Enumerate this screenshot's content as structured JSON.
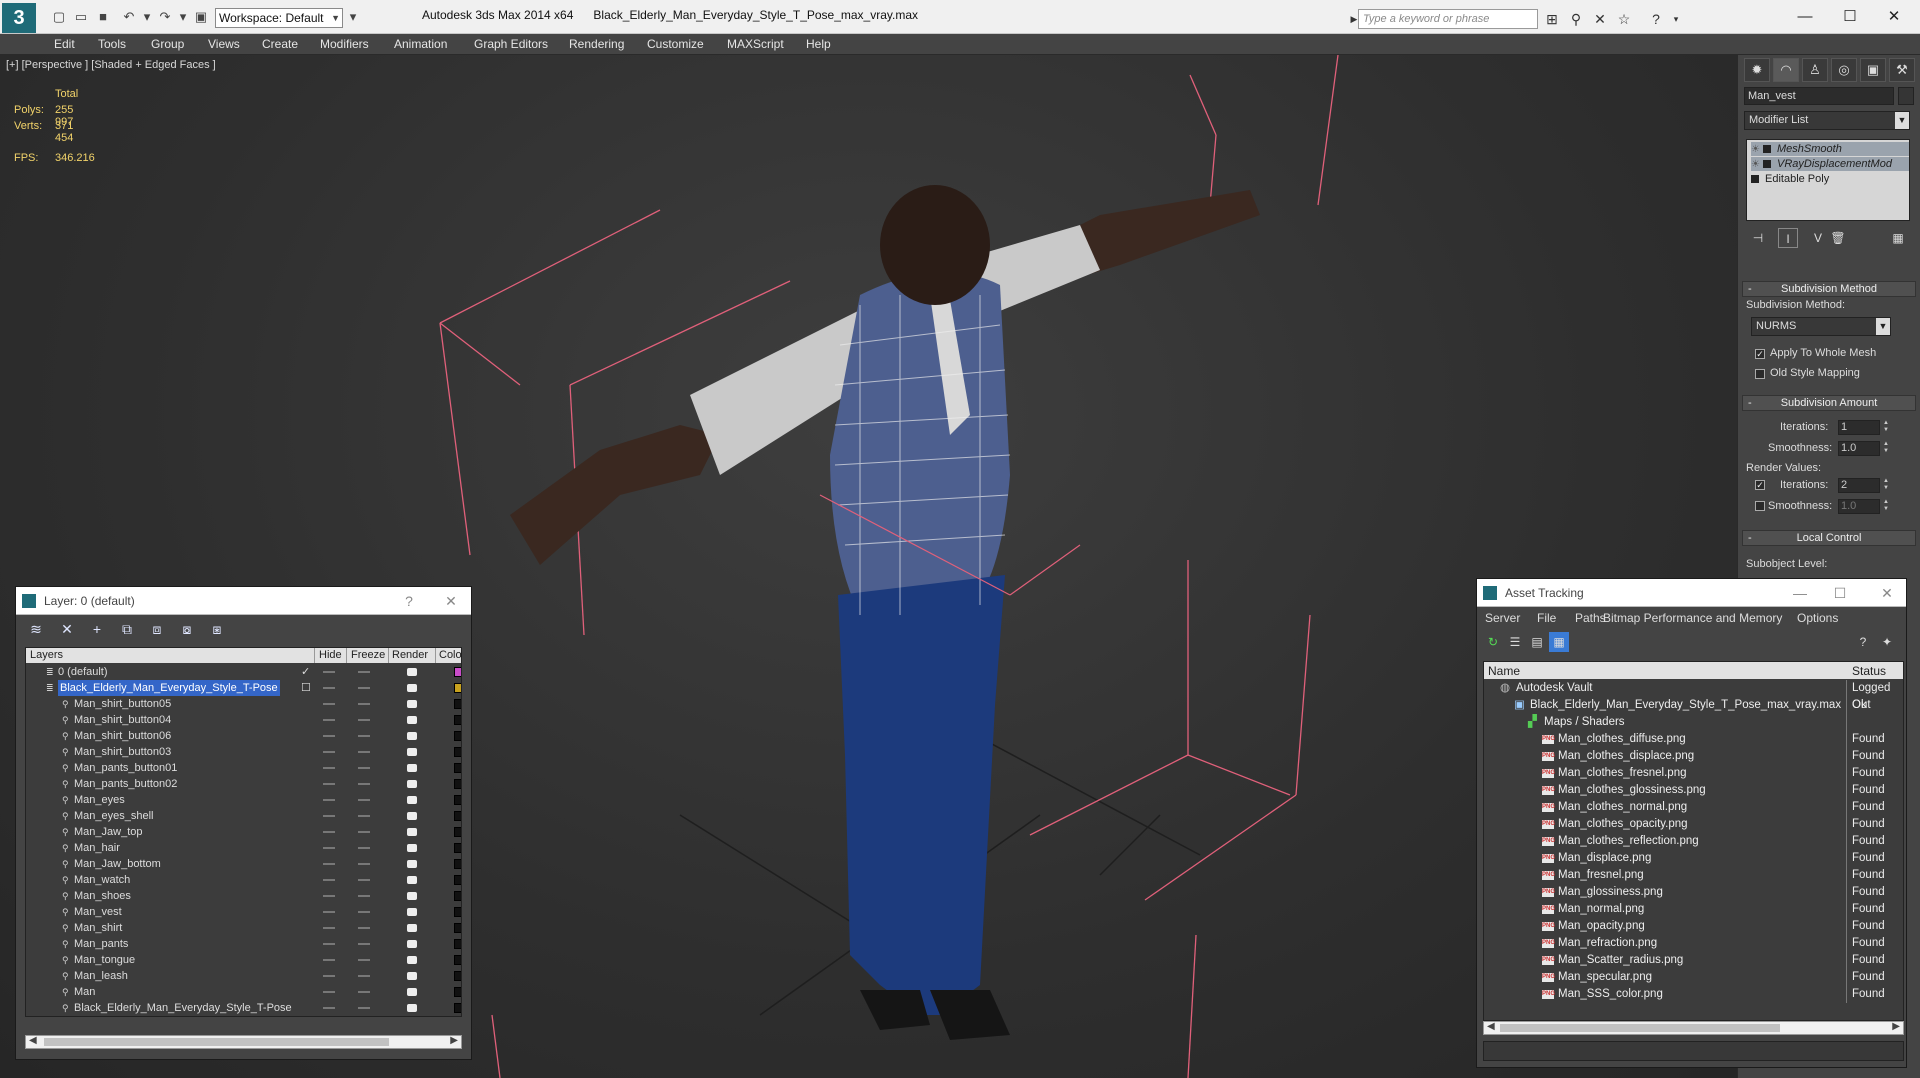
{
  "app": {
    "logo_text": "3",
    "workspace": "Workspace: Default",
    "title": "Autodesk 3ds Max  2014 x64",
    "file": "Black_Elderly_Man_Everyday_Style_T_Pose_max_vray.max",
    "search_placeholder": "Type a keyword or phrase"
  },
  "menu": [
    "Edit",
    "Tools",
    "Group",
    "Views",
    "Create",
    "Modifiers",
    "Animation",
    "Graph Editors",
    "Rendering",
    "Customize",
    "MAXScript",
    "Help"
  ],
  "viewport": {
    "label": "[+] [Perspective ] [Shaded + Edged Faces ]",
    "stats": {
      "total_label": "Total",
      "polys_label": "Polys:",
      "polys": "255 997",
      "verts_label": "Verts:",
      "verts": "371 454",
      "fps_label": "FPS:",
      "fps": "346.216"
    }
  },
  "command_panel": {
    "object_name": "Man_vest",
    "modifier_list": "Modifier List",
    "stack": [
      "MeshSmooth",
      "VRayDisplacementMod",
      "Editable Poly"
    ],
    "subdivision_method_title": "Subdivision Method",
    "subdivision_method_label": "Subdivision Method:",
    "subdivision_method_value": "NURMS",
    "apply_whole_mesh": "Apply To Whole Mesh",
    "old_style_mapping": "Old Style Mapping",
    "subdivision_amount_title": "Subdivision Amount",
    "iterations_label": "Iterations:",
    "iterations": "1",
    "smoothness_label": "Smoothness:",
    "smoothness": "1.0",
    "render_values_label": "Render Values:",
    "render_iterations": "2",
    "render_smoothness": "1.0",
    "local_control_title": "Local Control",
    "subobject_level_label": "Subobject Level:"
  },
  "layer_window": {
    "title": "Layer: 0 (default)",
    "help": "?",
    "columns": [
      "Layers",
      "Hide",
      "Freeze",
      "Render",
      "Colo"
    ],
    "default_layer": "0 (default)",
    "selected_layer": "Black_Elderly_Man_Everyday_Style_T-Pose",
    "objects": [
      "Man_shirt_button05",
      "Man_shirt_button04",
      "Man_shirt_button06",
      "Man_shirt_button03",
      "Man_pants_button01",
      "Man_pants_button02",
      "Man_eyes",
      "Man_eyes_shell",
      "Man_Jaw_top",
      "Man_hair",
      "Man_Jaw_bottom",
      "Man_watch",
      "Man_shoes",
      "Man_vest",
      "Man_shirt",
      "Man_pants",
      "Man_tongue",
      "Man_leash",
      "Man",
      "Black_Elderly_Man_Everyday_Style_T-Pose"
    ],
    "colors": {
      "default_layer": "#c84cc8",
      "selected_layer": "#c8a21e",
      "object": "#111111"
    }
  },
  "asset_window": {
    "title": "Asset Tracking",
    "menu": [
      "Server",
      "File",
      "Paths",
      "Bitmap Performance and Memory",
      "Options"
    ],
    "columns": [
      "Name",
      "Status"
    ],
    "vault": "Autodesk Vault",
    "vault_status": "Logged Out",
    "max_file": "Black_Elderly_Man_Everyday_Style_T_Pose_max_vray.max",
    "max_status": "Ok",
    "maps_label": "Maps / Shaders",
    "png_badge": "PNG",
    "files": [
      {
        "name": "Man_clothes_diffuse.png",
        "status": "Found"
      },
      {
        "name": "Man_clothes_displace.png",
        "status": "Found"
      },
      {
        "name": "Man_clothes_fresnel.png",
        "status": "Found"
      },
      {
        "name": "Man_clothes_glossiness.png",
        "status": "Found"
      },
      {
        "name": "Man_clothes_normal.png",
        "status": "Found"
      },
      {
        "name": "Man_clothes_opacity.png",
        "status": "Found"
      },
      {
        "name": "Man_clothes_reflection.png",
        "status": "Found"
      },
      {
        "name": "Man_displace.png",
        "status": "Found"
      },
      {
        "name": "Man_fresnel.png",
        "status": "Found"
      },
      {
        "name": "Man_glossiness.png",
        "status": "Found"
      },
      {
        "name": "Man_normal.png",
        "status": "Found"
      },
      {
        "name": "Man_opacity.png",
        "status": "Found"
      },
      {
        "name": "Man_refraction.png",
        "status": "Found"
      },
      {
        "name": "Man_Scatter_radius.png",
        "status": "Found"
      },
      {
        "name": "Man_specular.png",
        "status": "Found"
      },
      {
        "name": "Man_SSS_color.png",
        "status": "Found"
      }
    ]
  },
  "colors": {
    "stats": "#f2d36a",
    "selection": "#3466c8",
    "bbox": "#e0607a"
  }
}
